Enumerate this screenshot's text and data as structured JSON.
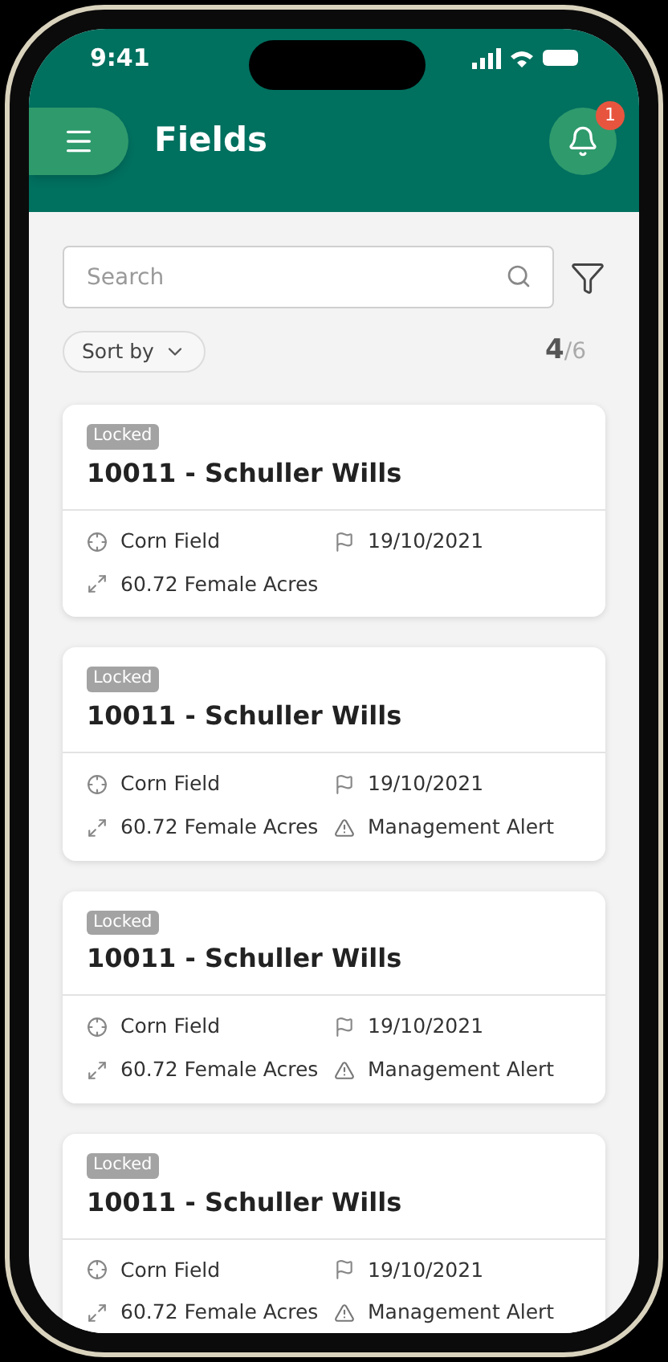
{
  "status_bar": {
    "time": "9:41"
  },
  "header": {
    "title": "Fields",
    "notifications": "1"
  },
  "search": {
    "placeholder": "Search"
  },
  "sort": {
    "label": "Sort by"
  },
  "count": {
    "shown": "4",
    "total": "/6"
  },
  "cards": [
    {
      "badge": "Locked",
      "title": "10011 - Schuller Wills",
      "crop": "Corn Field",
      "date": "19/10/2021",
      "area": "60.72 Female Acres"
    },
    {
      "badge": "Locked",
      "title": "10011 - Schuller Wills",
      "crop": "Corn Field",
      "date": "19/10/2021",
      "area": "60.72 Female Acres",
      "alert": "Management Alert"
    },
    {
      "badge": "Locked",
      "title": "10011 - Schuller Wills",
      "crop": "Corn Field",
      "date": "19/10/2021",
      "area": "60.72 Female Acres",
      "alert": "Management Alert"
    },
    {
      "badge": "Locked",
      "title": "10011 - Schuller Wills",
      "crop": "Corn Field",
      "date": "19/10/2021",
      "area": "60.72 Female Acres",
      "alert": "Management Alert"
    }
  ]
}
